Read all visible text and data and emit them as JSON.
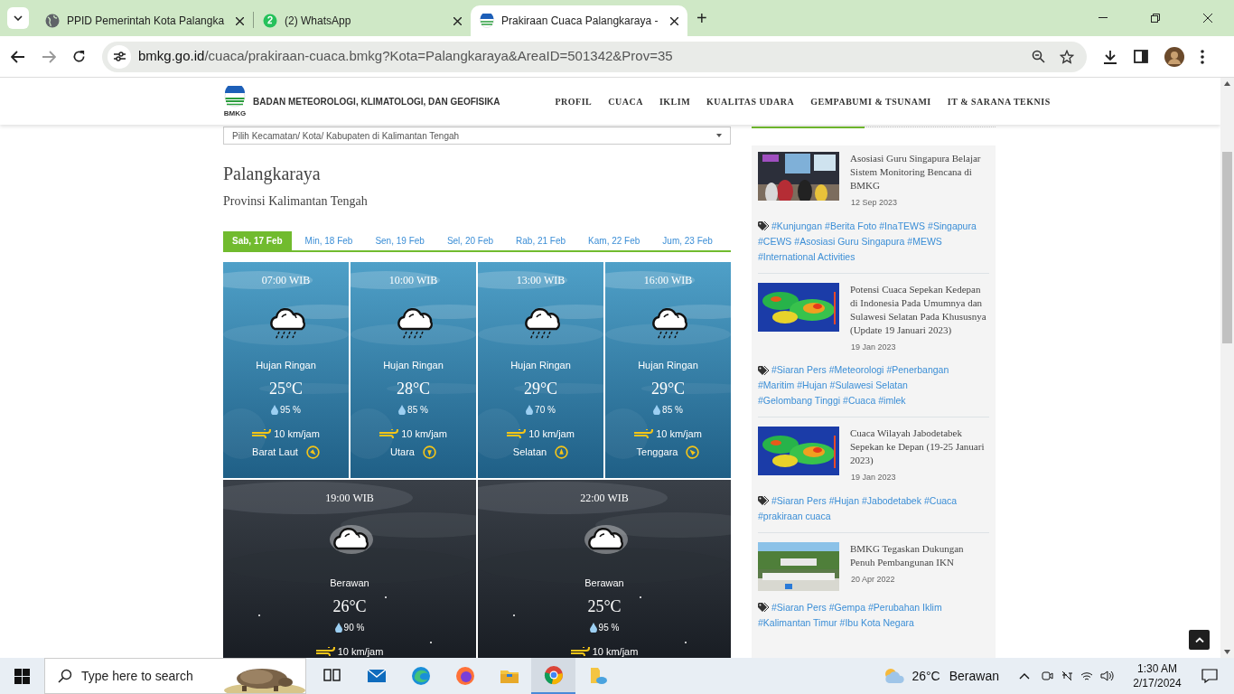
{
  "browser": {
    "tabs": [
      {
        "title": "PPID Pemerintah Kota Palangka",
        "selected": false
      },
      {
        "title": "(2) WhatsApp",
        "selected": false
      },
      {
        "title": "Prakiraan Cuaca Palangkaraya -",
        "selected": true
      }
    ],
    "new_tab": "+",
    "url_host": "bmkg.go.id",
    "url_path": "/cuaca/prakiraan-cuaca.bmkg?Kota=Palangkaraya&AreaID=501342&Prov=35"
  },
  "site": {
    "logo_caption": "BMKG",
    "name": "BADAN METEOROLOGI, KLIMATOLOGI, DAN GEOFISIKA",
    "nav": [
      "PROFIL",
      "CUACA",
      "IKLIM",
      "KUALITAS UDARA",
      "GEMPABUMI & TSUNAMI",
      "IT & SARANA TEKNIS"
    ]
  },
  "location_select": {
    "placeholder": "Pilih Kecamatan/ Kota/ Kabupaten di Kalimantan Tengah"
  },
  "city": "Palangkaraya",
  "province": "Provinsi Kalimantan Tengah",
  "day_tabs": [
    {
      "label": "Sab, 17 Feb",
      "selected": true
    },
    {
      "label": "Min, 18 Feb",
      "selected": false
    },
    {
      "label": "Sen, 19 Feb",
      "selected": false
    },
    {
      "label": "Sel, 20 Feb",
      "selected": false
    },
    {
      "label": "Rab, 21 Feb",
      "selected": false
    },
    {
      "label": "Kam, 22 Feb",
      "selected": false
    },
    {
      "label": "Jum, 23 Feb",
      "selected": false
    }
  ],
  "forecasts": [
    {
      "kind": "day",
      "time": "07:00 WIB",
      "condition": "Hujan Ringan",
      "temperature": "25°C",
      "humidity": "95 %",
      "wind_speed": "10 km/jam",
      "wind_direction": "Barat Laut"
    },
    {
      "kind": "day",
      "time": "10:00 WIB",
      "condition": "Hujan Ringan",
      "temperature": "28°C",
      "humidity": "85 %",
      "wind_speed": "10 km/jam",
      "wind_direction": "Utara"
    },
    {
      "kind": "day",
      "time": "13:00 WIB",
      "condition": "Hujan Ringan",
      "temperature": "29°C",
      "humidity": "70 %",
      "wind_speed": "10 km/jam",
      "wind_direction": "Selatan"
    },
    {
      "kind": "day",
      "time": "16:00 WIB",
      "condition": "Hujan Ringan",
      "temperature": "29°C",
      "humidity": "85 %",
      "wind_speed": "10 km/jam",
      "wind_direction": "Tenggara"
    },
    {
      "kind": "night",
      "time": "19:00 WIB",
      "condition": "Berawan",
      "temperature": "26°C",
      "humidity": "90 %",
      "wind_speed": "10 km/jam"
    },
    {
      "kind": "night",
      "time": "22:00 WIB",
      "condition": "Berawan",
      "temperature": "25°C",
      "humidity": "95 %",
      "wind_speed": "10 km/jam"
    }
  ],
  "news": [
    {
      "title": "Asosiasi Guru Singapura Belajar Sistem Monitoring Bencana di BMKG",
      "date": "12 Sep 2023",
      "tags": [
        "#Kunjungan",
        "#Berita Foto",
        "#InaTEWS",
        "#Singapura",
        "#CEWS",
        "#Asosiasi Guru Singapura",
        "#MEWS",
        "#International Activities"
      ]
    },
    {
      "title": "Potensi Cuaca Sepekan Kedepan di Indonesia Pada Umumnya dan Sulawesi Selatan Pada Khususnya (Update 19 Januari 2023)",
      "date": "19 Jan 2023",
      "tags": [
        "#Siaran Pers",
        "#Meteorologi",
        "#Penerbangan",
        "#Maritim",
        "#Hujan",
        "#Sulawesi Selatan",
        "#Gelombang Tinggi",
        "#Cuaca",
        "#imlek"
      ]
    },
    {
      "title": "Cuaca Wilayah Jabodetabek Sepekan ke Depan (19-25 Januari 2023)",
      "date": "19 Jan 2023",
      "tags": [
        "#Siaran Pers",
        "#Hujan",
        "#Jabodetabek",
        "#Cuaca",
        "#prakiraan cuaca"
      ]
    },
    {
      "title": "BMKG Tegaskan Dukungan Penuh Pembangunan IKN",
      "date": "20 Apr 2022",
      "tags": [
        "#Siaran Pers",
        "#Gempa",
        "#Perubahan Iklim",
        "#Kalimantan Timur",
        "#Ibu Kota Negara"
      ]
    }
  ],
  "taskbar": {
    "search_placeholder": "Type here to search",
    "weather_temp": "26°C",
    "weather_text": "Berawan",
    "time": "1:30 AM",
    "date": "2/17/2024"
  }
}
